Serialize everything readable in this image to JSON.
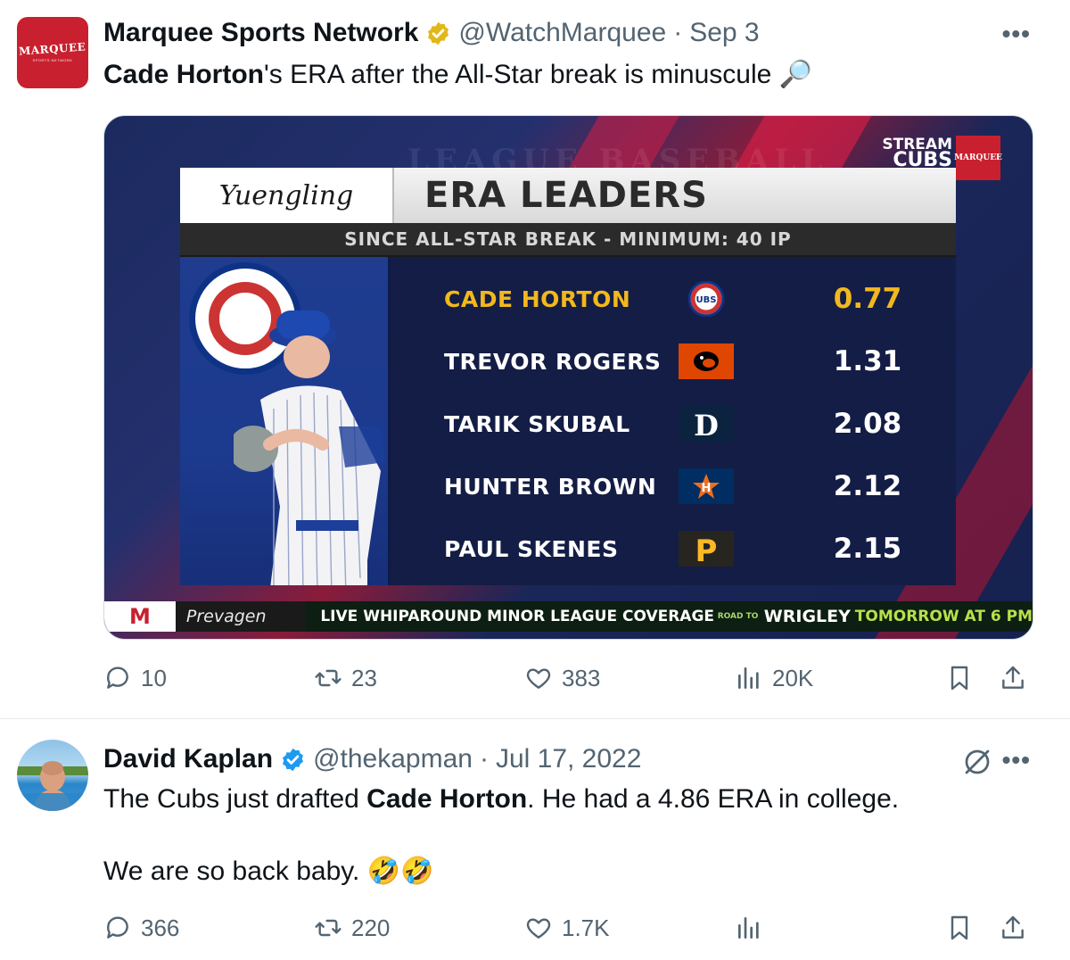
{
  "tweet1": {
    "avatar": {
      "logo_text": "MARQUEE",
      "sub_text": "SPORTS NETWORK"
    },
    "name": "Marquee Sports Network",
    "handle": "@WatchMarquee",
    "separator": "·",
    "date": "Sep 3",
    "text_bold": "Cade Horton",
    "text_rest": "'s ERA after the All-Star break is minuscule",
    "emoji": "🔎",
    "media": {
      "bg_text_top": "LEAGUE BASEBALL",
      "stream_label_1": "STREAM",
      "stream_label_2": "CUBS",
      "badge": "MARQUEE",
      "sponsor": "Yuengling",
      "title": "ERA LEADERS",
      "subtitle": "SINCE ALL-STAR BREAK - MINIMUM: 40 IP",
      "leaders": [
        {
          "name": "CADE HORTON",
          "team_icon": "cubs-logo-icon",
          "era": "0.77"
        },
        {
          "name": "TREVOR ROGERS",
          "team_icon": "orioles-logo-icon",
          "era": "1.31"
        },
        {
          "name": "TARIK SKUBAL",
          "team_icon": "tigers-logo-icon",
          "era": "2.08"
        },
        {
          "name": "HUNTER BROWN",
          "team_icon": "astros-logo-icon",
          "era": "2.12"
        },
        {
          "name": "PAUL SKENES",
          "team_icon": "pirates-logo-icon",
          "era": "2.15"
        }
      ],
      "ticker": {
        "m": "M",
        "sponsor": "Prevagen",
        "headline": "LIVE WHIPAROUND MINOR LEAGUE COVERAGE",
        "road_to": "ROAD TO",
        "wrigley": "WRIGLEY",
        "time": "TOMORROW AT 6 PM"
      }
    },
    "actions": {
      "replies": "10",
      "reposts": "23",
      "likes": "383",
      "views": "20K"
    }
  },
  "tweet2": {
    "name": "David Kaplan",
    "handle": "@thekapman",
    "separator": "·",
    "date": "Jul 17, 2022",
    "line1_pre": "The Cubs just drafted ",
    "line1_bold": "Cade Horton",
    "line1_post": ". He had a 4.86 ERA in college.",
    "line2": "We are so back baby.",
    "line2_emoji": "🤣🤣",
    "actions": {
      "replies": "366",
      "reposts": "220",
      "likes": "1.7K"
    }
  },
  "colors": {
    "verified_gold": "#e2b719",
    "verified_blue": "#1d9bf0",
    "secondary_text": "#536471",
    "leader_gold": "#f2b81d"
  }
}
